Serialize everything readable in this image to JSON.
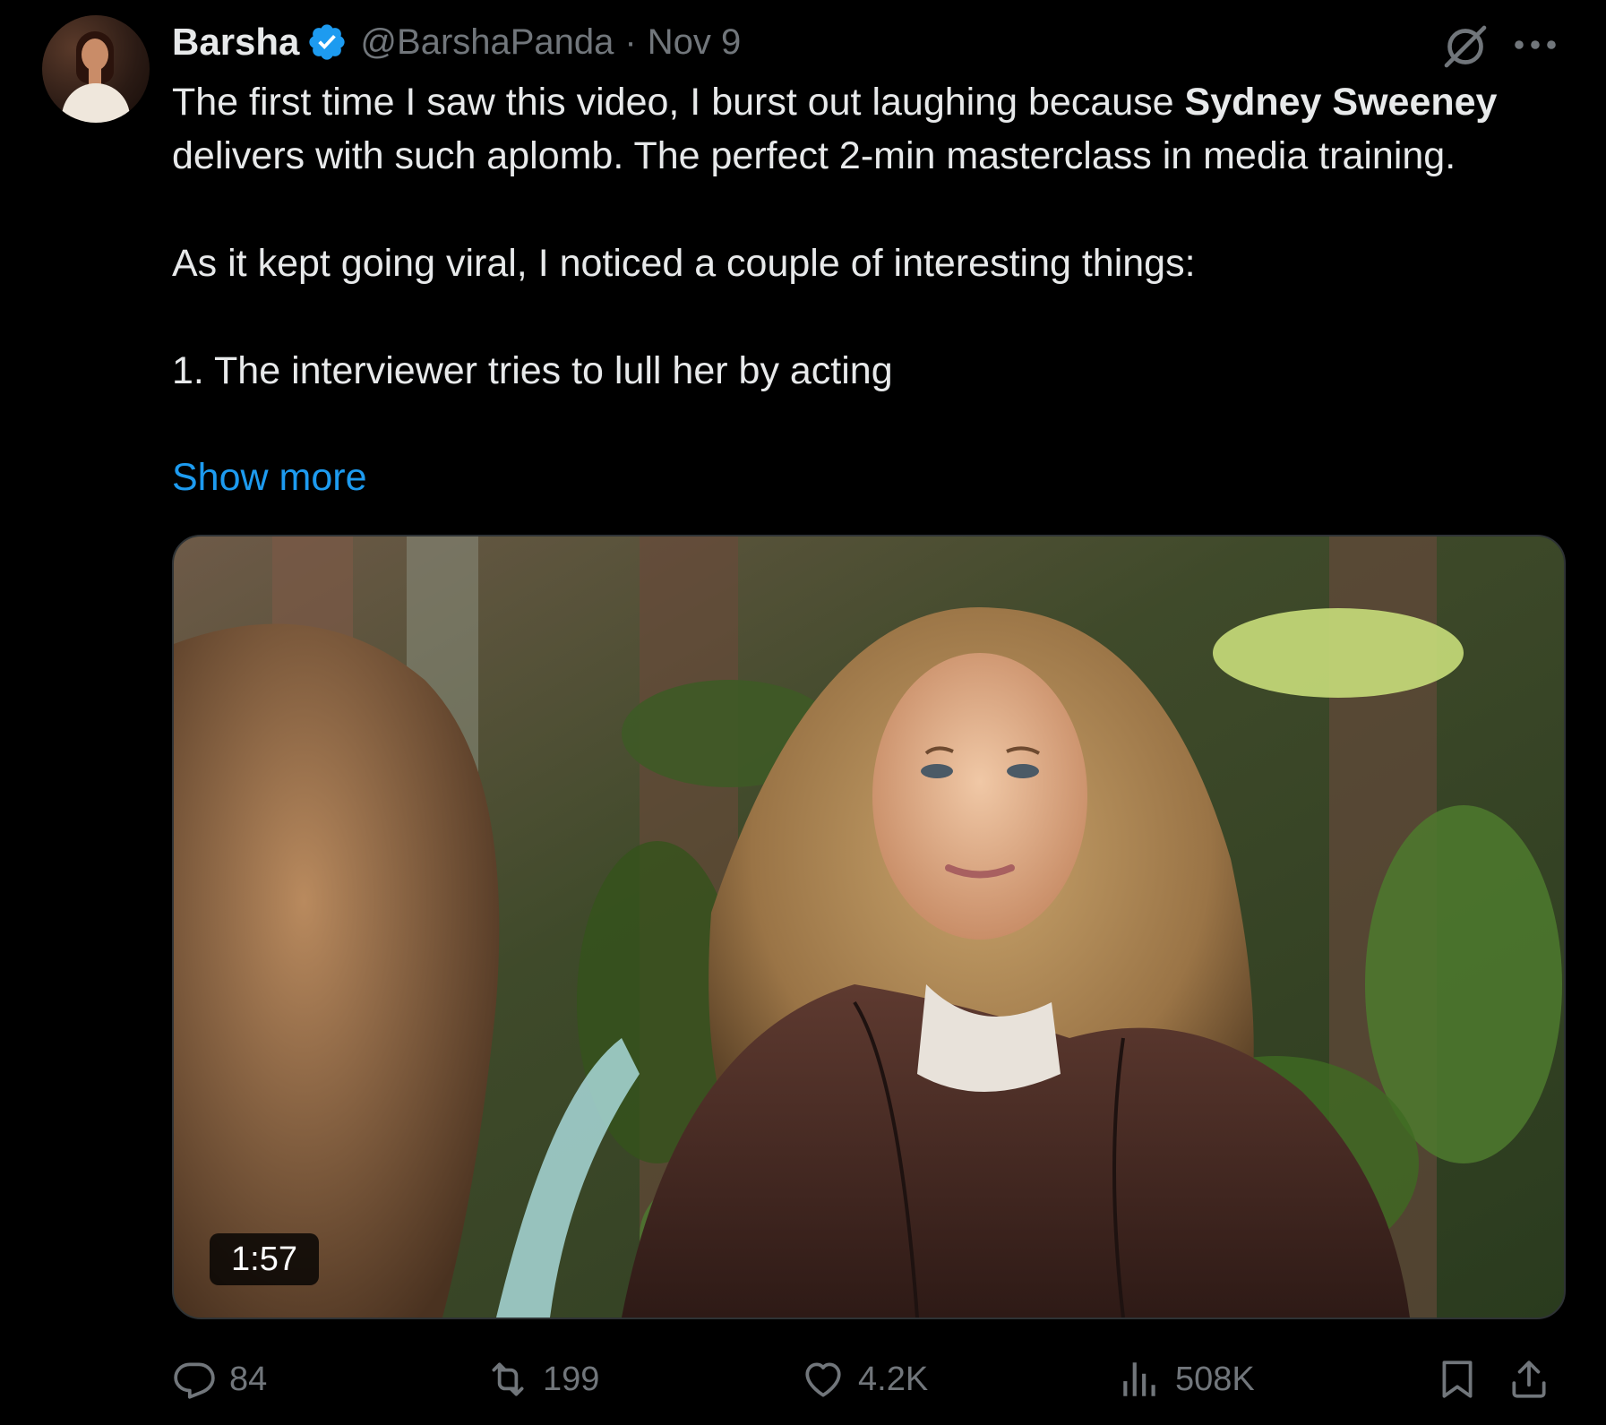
{
  "author": {
    "display_name": "Barsha",
    "handle": "@BarshaPanda",
    "separator": "·",
    "date": "Nov 9",
    "verified": true
  },
  "tweet": {
    "line1_plain": "The first time I saw this video, I burst out laughing because ",
    "line1_bold": "Sydney Sweeney",
    "line1_rest": " delivers with such aplomb. The perfect 2-min masterclass in media training.",
    "para2": "As it kept going viral, I noticed a couple of interesting things:",
    "para3": "1. The interviewer tries to lull her by acting",
    "show_more": "Show more"
  },
  "video": {
    "duration": "1:57"
  },
  "actions": {
    "replies": "84",
    "reposts": "199",
    "likes": "4.2K",
    "views": "508K"
  },
  "icons": {
    "verified": "verified-badge-icon",
    "grok": "grok-icon",
    "more": "more-icon",
    "reply": "reply-icon",
    "repost": "repost-icon",
    "like": "heart-icon",
    "views": "views-icon",
    "bookmark": "bookmark-icon",
    "share": "share-icon"
  },
  "colors": {
    "background": "#000000",
    "text": "#e7e9ea",
    "muted": "#71767b",
    "link": "#1d9bf0",
    "verified": "#1d9bf0"
  }
}
